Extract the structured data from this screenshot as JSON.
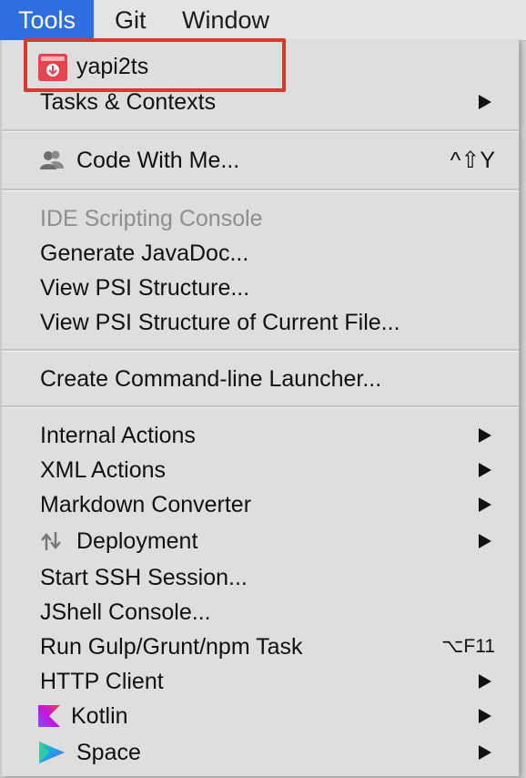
{
  "menubar": {
    "items": [
      {
        "label": "Tools",
        "active": true
      },
      {
        "label": "Git",
        "active": false
      },
      {
        "label": "Window",
        "active": false
      }
    ]
  },
  "menu": {
    "items": [
      {
        "label": "yapi2ts",
        "icon": "yapi2ts-plugin-icon"
      },
      {
        "label": "Tasks & Contexts",
        "submenu": true
      },
      {
        "label": "Code With Me...",
        "icon": "people-icon",
        "shortcut": "^⇧Y"
      },
      {
        "label": "IDE Scripting Console",
        "disabled": true
      },
      {
        "label": "Generate JavaDoc..."
      },
      {
        "label": "View PSI Structure..."
      },
      {
        "label": "View PSI Structure of Current File..."
      },
      {
        "label": "Create Command-line Launcher..."
      },
      {
        "label": "Internal Actions",
        "submenu": true
      },
      {
        "label": "XML Actions",
        "submenu": true
      },
      {
        "label": "Markdown Converter",
        "submenu": true
      },
      {
        "label": "Deployment",
        "icon": "deployment-arrows-icon",
        "submenu": true
      },
      {
        "label": "Start SSH Session..."
      },
      {
        "label": "JShell Console..."
      },
      {
        "label": "Run Gulp/Grunt/npm Task",
        "shortcut": "⌥F11"
      },
      {
        "label": "HTTP Client",
        "submenu": true
      },
      {
        "label": "Kotlin",
        "icon": "kotlin-icon",
        "submenu": true
      },
      {
        "label": "Space",
        "icon": "space-icon",
        "submenu": true
      }
    ]
  },
  "colors": {
    "menubar_active": "#2f6fe0",
    "highlight_box": "#d63a2f",
    "disabled_text": "#8e8e8e"
  }
}
